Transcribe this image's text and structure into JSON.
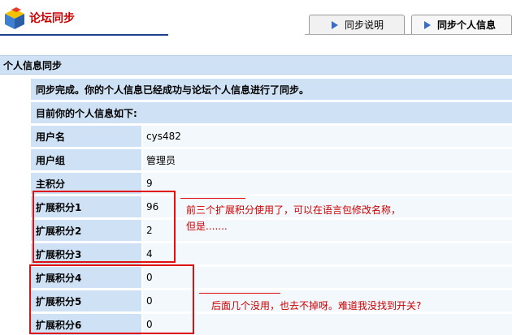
{
  "header": {
    "title": "论坛同步",
    "logo_icon": "cube-logo-icon"
  },
  "tabs": [
    {
      "label": "同步说明",
      "active": false
    },
    {
      "label": "同步个人信息",
      "active": true
    }
  ],
  "section": {
    "title": "个人信息同步"
  },
  "messages": {
    "success": "同步完成。你的个人信息已经成功与论坛个人信息进行了同步。",
    "intro": "目前你的个人信息如下:"
  },
  "fields": [
    {
      "label": "用户名",
      "value": "cys482"
    },
    {
      "label": "用户组",
      "value": "管理员"
    },
    {
      "label": "主积分",
      "value": "9"
    },
    {
      "label": "扩展积分1",
      "value": "96"
    },
    {
      "label": "扩展积分2",
      "value": "2"
    },
    {
      "label": "扩展积分3",
      "value": "4"
    },
    {
      "label": "扩展积分4",
      "value": "0"
    },
    {
      "label": "扩展积分5",
      "value": "0"
    },
    {
      "label": "扩展积分6",
      "value": "0"
    }
  ],
  "annotations": {
    "note1_line1": "前三个扩展积分使用了，可以在语言包修改名称，",
    "note1_line2": "但是.......",
    "note2": "后面几个没用，也去不掉呀。难道我没找到开关?",
    "color": "#e01010"
  },
  "colors": {
    "accent": "#1e3f8a",
    "title": "#cc0000",
    "label_bg": "#cfe2f5",
    "value_bg": "#f3f8fc"
  }
}
